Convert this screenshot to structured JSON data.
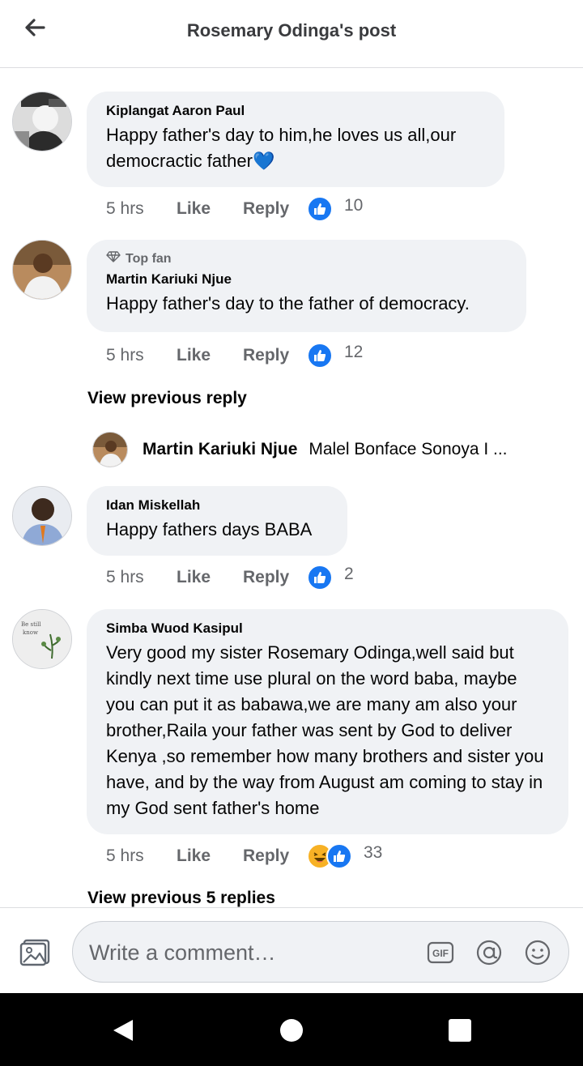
{
  "header": {
    "title": "Rosemary Odinga's post"
  },
  "comments": [
    {
      "author": "Kiplangat Aaron Paul",
      "text": "Happy father's day to him,he loves us all,our democractic father💙",
      "time": "5 hrs",
      "like_label": "Like",
      "reply_label": "Reply",
      "reaction_count": "10",
      "reactions": [
        "like"
      ]
    },
    {
      "badge": "Top fan",
      "author": "Martin Kariuki Njue",
      "text": "Happy father's day to the father of democracy.",
      "time": "5 hrs",
      "like_label": "Like",
      "reply_label": "Reply",
      "reaction_count": "12",
      "reactions": [
        "like"
      ],
      "view_previous": "View previous reply",
      "reply_preview": {
        "author": "Martin Kariuki Njue",
        "text": "Malel Bonface Sonoya I ..."
      }
    },
    {
      "author": "Idan Miskellah",
      "text": "Happy fathers days BABA",
      "time": "5 hrs",
      "like_label": "Like",
      "reply_label": "Reply",
      "reaction_count": "2",
      "reactions": [
        "like"
      ]
    },
    {
      "author": "Simba Wuod Kasipul",
      "text": "Very good my sister Rosemary Odinga,well said but kindly next time use plural on the word baba, maybe you can put it as babawa,we are many am also your brother,Raila your father was sent by God to deliver Kenya ,so remember how many brothers and sister you have, and by the way from August am coming to stay in my God sent father's home",
      "time": "5 hrs",
      "like_label": "Like",
      "reply_label": "Reply",
      "reaction_count": "33",
      "reactions": [
        "haha",
        "like"
      ],
      "view_previous": "View previous 5 replies"
    }
  ],
  "composer": {
    "placeholder": "Write a comment…"
  },
  "colors": {
    "accent": "#1877f2",
    "bubble": "#f0f2f5",
    "secondary_text": "#65676b"
  }
}
